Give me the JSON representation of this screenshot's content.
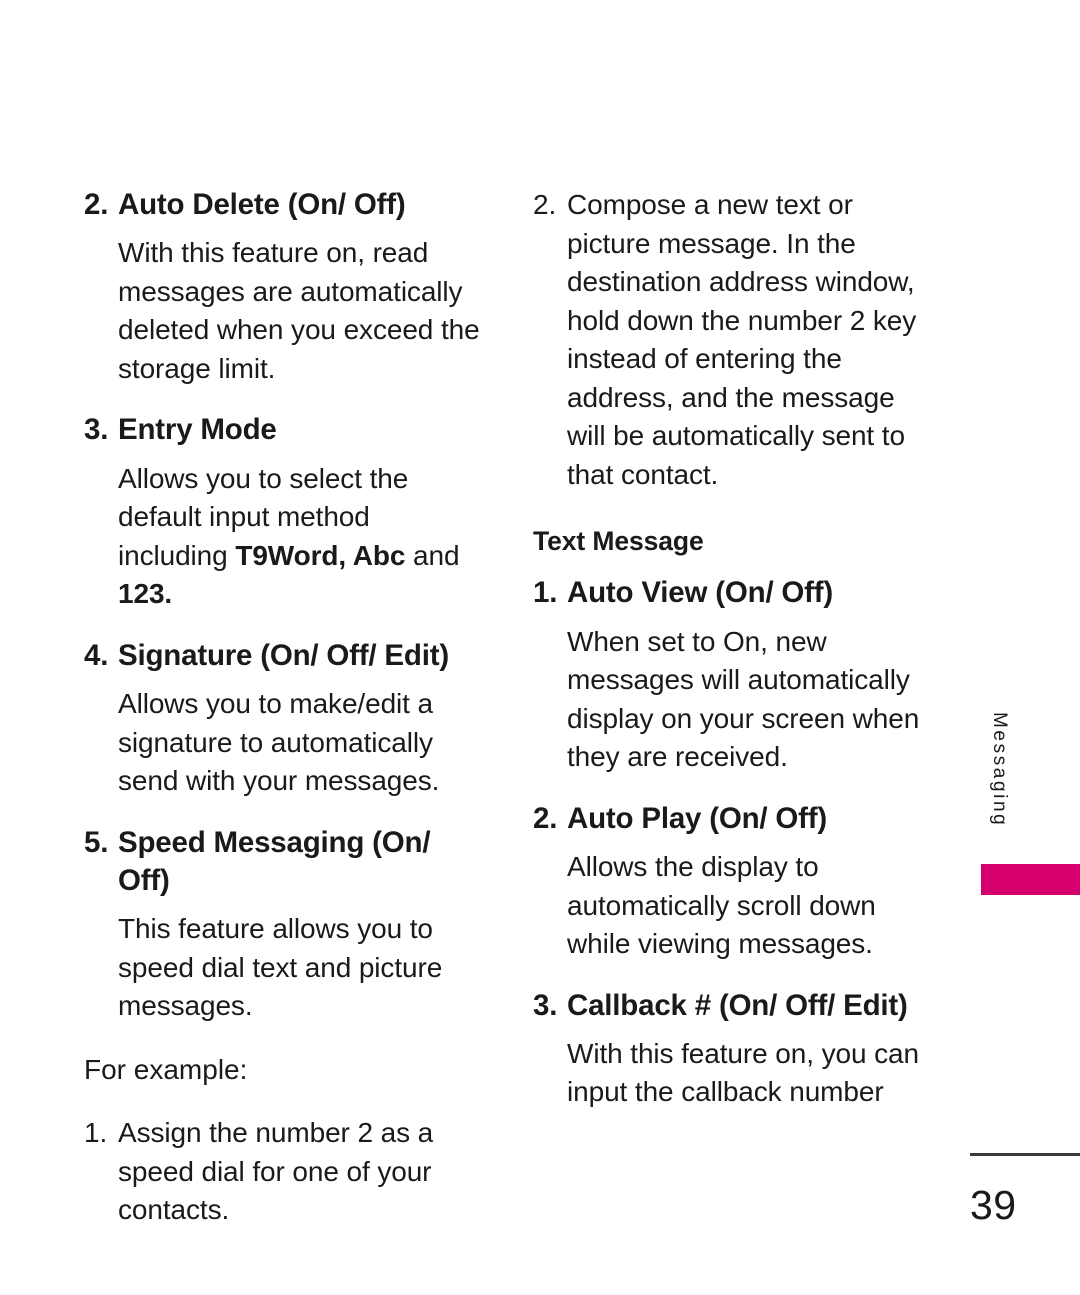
{
  "page": {
    "number": "39",
    "side_tab_label": "Messaging",
    "accent_color": "#d5006d",
    "text_color": "#1a1a1a",
    "background": "#ffffff"
  },
  "left_column": {
    "item2": {
      "num": "2.",
      "heading": "Auto Delete (On/ Off)",
      "body": "With this feature on, read messages are automatically deleted when you exceed the storage limit."
    },
    "item3": {
      "num": "3.",
      "heading": "Entry Mode",
      "body_part1": "Allows you to select the default input method including ",
      "body_bold1": "T9Word, Abc",
      "body_part2": " and ",
      "body_bold2": "123."
    },
    "item4": {
      "num": "4.",
      "heading": "Signature (On/ Off/ Edit)",
      "body": "Allows you to make/edit a signature to automatically send with your messages."
    },
    "item5": {
      "num": "5.",
      "heading": "Speed Messaging (On/ Off)",
      "body": "This feature allows you to speed dial text and picture messages."
    },
    "for_example_label": "For example:",
    "example1": {
      "num": "1.",
      "body": "Assign the number 2 as a speed dial for one of your contacts."
    }
  },
  "right_column": {
    "example2": {
      "num": "2.",
      "body": "Compose a new text or picture message. In the destination address window, hold down the number 2 key instead of entering the address, and the message will be automatically sent to that contact."
    },
    "section_title": "Text Message",
    "item1": {
      "num": "1.",
      "heading": "Auto View (On/ Off)",
      "body": "When set to On, new messages will automatically display on your screen when they are received."
    },
    "item2": {
      "num": "2.",
      "heading": "Auto Play (On/ Off)",
      "body": "Allows the display to automatically scroll down while viewing messages."
    },
    "item3": {
      "num": "3.",
      "heading": "Callback # (On/ Off/ Edit)",
      "body": "With this feature on, you can input the callback number"
    }
  }
}
